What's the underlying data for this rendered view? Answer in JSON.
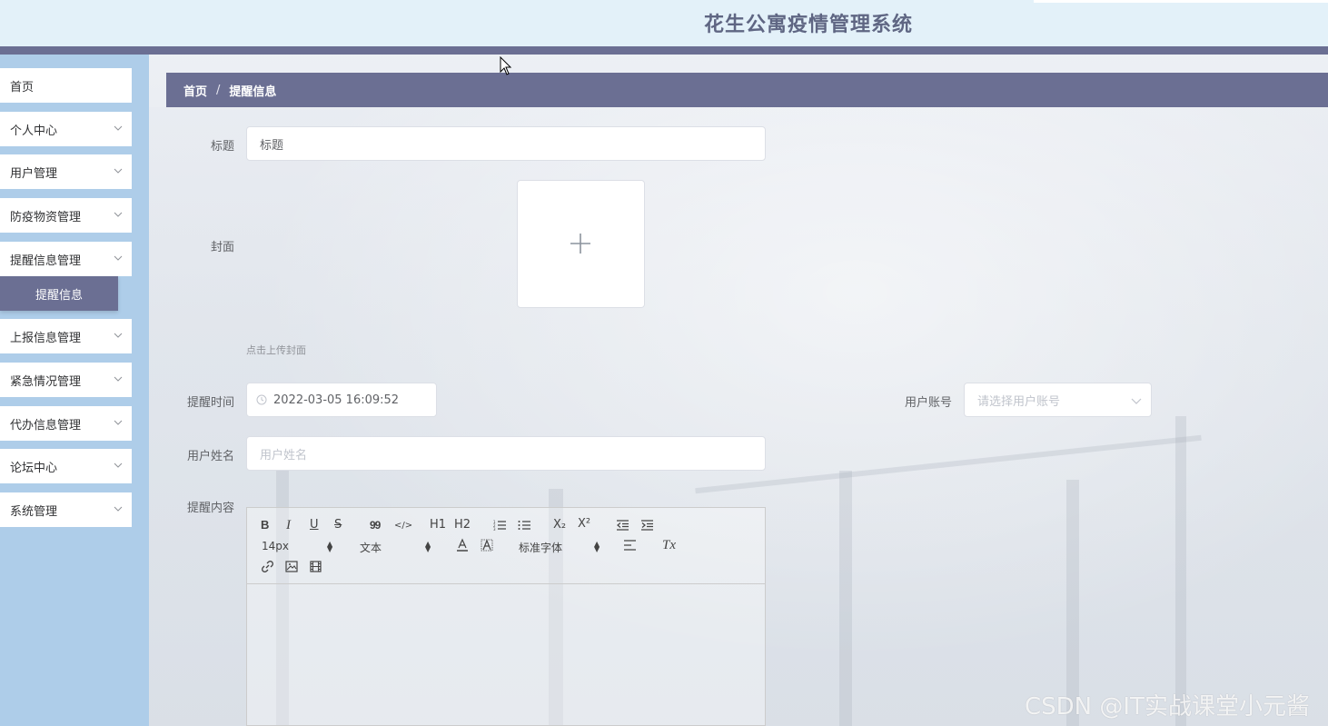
{
  "header": {
    "title": "花生公寓疫情管理系统"
  },
  "sidebar": {
    "items": [
      {
        "label": "首页",
        "has_children": false
      },
      {
        "label": "个人中心",
        "has_children": true
      },
      {
        "label": "用户管理",
        "has_children": true
      },
      {
        "label": "防疫物资管理",
        "has_children": true
      },
      {
        "label": "提醒信息管理",
        "has_children": true
      },
      {
        "label": "上报信息管理",
        "has_children": true
      },
      {
        "label": "紧急情况管理",
        "has_children": true
      },
      {
        "label": "代办信息管理",
        "has_children": true
      },
      {
        "label": "论坛中心",
        "has_children": true
      },
      {
        "label": "系统管理",
        "has_children": true
      }
    ],
    "active_sub": "提醒信息"
  },
  "breadcrumb": {
    "home": "首页",
    "separator": "/",
    "current": "提醒信息"
  },
  "form": {
    "title": {
      "label": "标题",
      "value": "标题"
    },
    "cover": {
      "label": "封面",
      "tip": "点击上传封面"
    },
    "remind_time": {
      "label": "提醒时间",
      "value": "2022-03-05 16:09:52"
    },
    "user_account": {
      "label": "用户账号",
      "placeholder": "请选择用户账号"
    },
    "user_name": {
      "label": "用户姓名",
      "placeholder": "用户姓名"
    },
    "content": {
      "label": "提醒内容"
    }
  },
  "editor": {
    "font_size": "14px",
    "header_select": "文本",
    "font_family": "标准字体",
    "buttons": {
      "bold": "B",
      "italic": "I",
      "underline": "U",
      "strike": "S",
      "quote": "99",
      "code": "</>",
      "h1": "H1",
      "h2": "H2",
      "sub": "X₂",
      "sup": "X²",
      "clean": "Tx"
    }
  },
  "watermark": "CSDN @IT实战课堂小元酱",
  "colors": {
    "header_bg": "#e3f1f9",
    "accent": "#6b6f93",
    "sidebar_bg": "#aecde9",
    "title_color": "#5f6683"
  }
}
